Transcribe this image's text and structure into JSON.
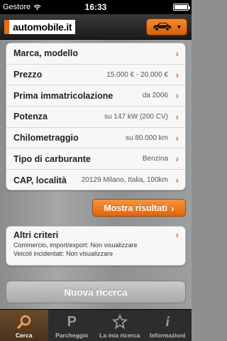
{
  "status_bar": {
    "carrier": "Gestore",
    "time": "16:33"
  },
  "header": {
    "logo_text": "automobile.it",
    "car_menu_icon": "car-icon"
  },
  "criteria": [
    {
      "label": "Marca, modello",
      "value": ""
    },
    {
      "label": "Prezzo",
      "value": "15.000 € - 20.000 €"
    },
    {
      "label": "Prima immatricolazione",
      "value": "da 2006"
    },
    {
      "label": "Potenza",
      "value": "su 147 kW (200 CV)"
    },
    {
      "label": "Chilometraggio",
      "value": "su 80.000 km"
    },
    {
      "label": "Tipo di carburante",
      "value": "Benzina"
    },
    {
      "label": "CAP, località",
      "value": "20129 Milano, Italia, 100km"
    }
  ],
  "show_results_label": "Mostra risultati",
  "other_criteria": {
    "title": "Altri criteri",
    "lines": [
      "Commercio, import/export: Non visualizzare",
      "Veicoli incidentati: Non visualizzare"
    ]
  },
  "new_search_label": "Nuova ricerca",
  "tabs": [
    {
      "label": "Cerca",
      "icon": "search-icon",
      "active": true
    },
    {
      "label": "Parcheggio",
      "icon": "parking-icon",
      "active": false
    },
    {
      "label": "La mia ricerca",
      "icon": "star-icon",
      "active": false
    },
    {
      "label": "Informazioni",
      "icon": "info-icon",
      "active": false
    }
  ],
  "colors": {
    "accent": "#ea6b10",
    "tab_active": "#5a3e22"
  }
}
